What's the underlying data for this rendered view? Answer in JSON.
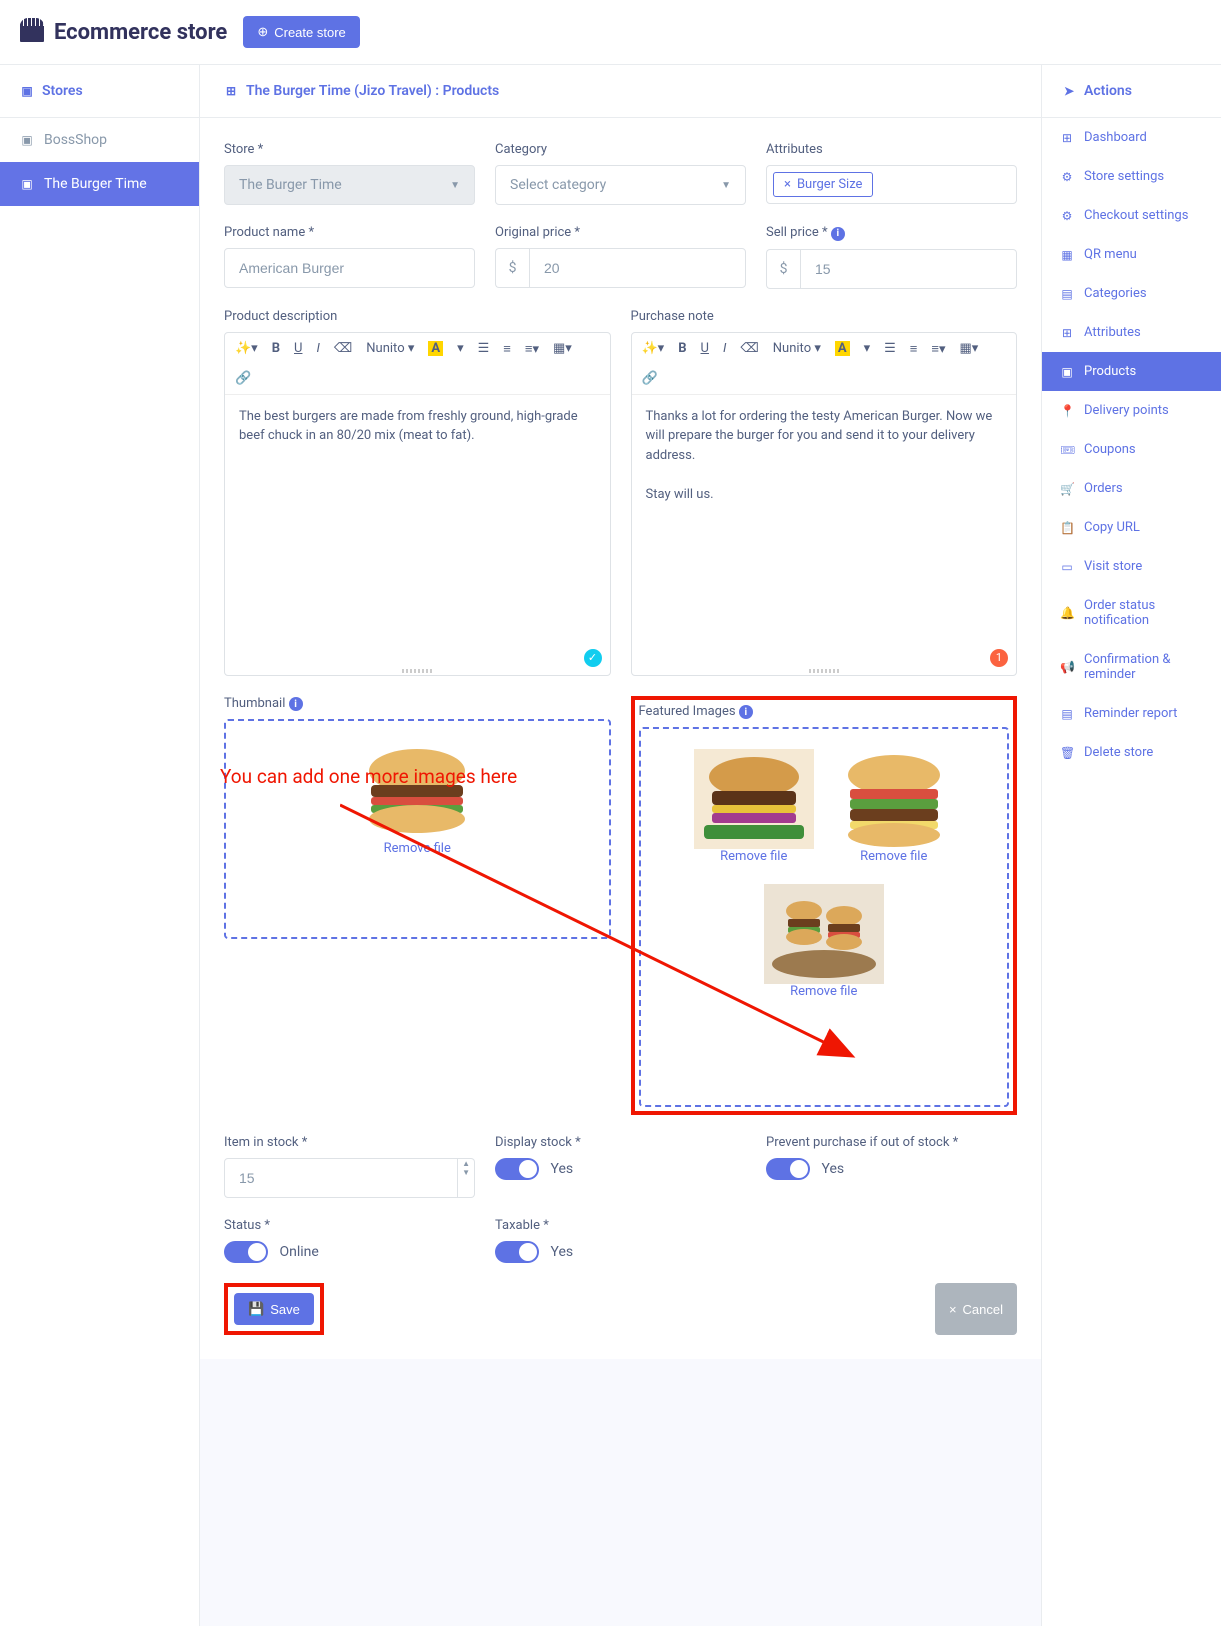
{
  "topbar": {
    "brand": "Ecommerce store",
    "create_btn": "Create store"
  },
  "sidebar_left": {
    "heading": "Stores",
    "items": [
      {
        "label": "BossShop",
        "active": false
      },
      {
        "label": "The Burger Time",
        "active": true
      }
    ]
  },
  "main": {
    "breadcrumb": "The Burger Time (Jizo Travel) : Products",
    "labels": {
      "store": "Store *",
      "category": "Category",
      "attributes": "Attributes",
      "product_name": "Product name *",
      "orig_price": "Original price *",
      "sell_price": "Sell price *",
      "description": "Product description",
      "purchase_note": "Purchase note",
      "thumbnail": "Thumbnail",
      "featured": "Featured Images",
      "item_stock": "Item in stock *",
      "display_stock": "Display stock *",
      "prevent": "Prevent purchase if out of stock *",
      "status": "Status *",
      "taxable": "Taxable *"
    },
    "values": {
      "store": "The Burger Time",
      "category_placeholder": "Select category",
      "attribute_tag": "Burger Size",
      "product_name": "American Burger",
      "currency": "$",
      "orig_price": "20",
      "sell_price": "15",
      "description_text": "The best burgers are made from freshly ground, high-grade beef chuck in an 80/20 mix (meat to fat).",
      "purchase_note_text": "Thanks a lot for ordering the testy American Burger. Now we will prepare the burger for you and send it to your delivery address.\n\nStay will us.",
      "font_name": "Nunito",
      "remove_file": "Remove file",
      "item_stock": "15",
      "display_stock": "Yes",
      "prevent": "Yes",
      "status": "Online",
      "taxable": "Yes",
      "save_btn": "Save",
      "cancel_btn": "Cancel",
      "warn_badge": "1"
    }
  },
  "sidebar_right": {
    "heading": "Actions",
    "items": [
      "Dashboard",
      "Store settings",
      "Checkout settings",
      "QR menu",
      "Categories",
      "Attributes",
      "Products",
      "Delivery points",
      "Coupons",
      "Orders",
      "Copy URL",
      "Visit store",
      "Order status notification",
      "Confirmation & reminder",
      "Reminder report",
      "Delete store"
    ],
    "active_index": 6
  },
  "annotation": {
    "text": "You can add one more images here"
  }
}
